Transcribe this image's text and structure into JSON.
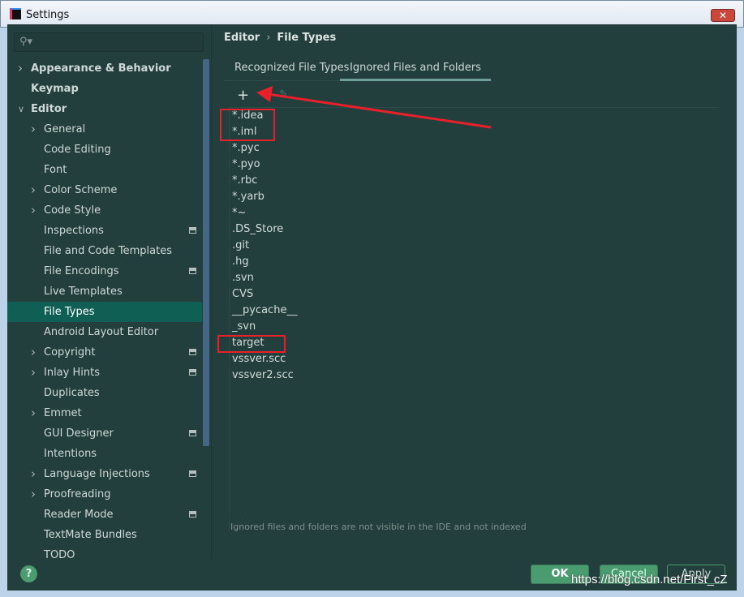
{
  "window": {
    "title": "Settings",
    "close": "✕"
  },
  "search": {
    "icon": "search-icon",
    "placeholder": ""
  },
  "sidebar": {
    "items": [
      {
        "label": "Appearance & Behavior",
        "level": 0,
        "chevron": "right",
        "bold": true
      },
      {
        "label": "Keymap",
        "level": 0,
        "chevron": "",
        "bold": true
      },
      {
        "label": "Editor",
        "level": 0,
        "chevron": "down",
        "bold": true
      },
      {
        "label": "General",
        "level": 1,
        "chevron": "right"
      },
      {
        "label": "Code Editing",
        "level": 1,
        "chevron": ""
      },
      {
        "label": "Font",
        "level": 1,
        "chevron": ""
      },
      {
        "label": "Color Scheme",
        "level": 1,
        "chevron": "right"
      },
      {
        "label": "Code Style",
        "level": 1,
        "chevron": "right"
      },
      {
        "label": "Inspections",
        "level": 1,
        "chevron": "",
        "badge": true
      },
      {
        "label": "File and Code Templates",
        "level": 1,
        "chevron": ""
      },
      {
        "label": "File Encodings",
        "level": 1,
        "chevron": "",
        "badge": true
      },
      {
        "label": "Live Templates",
        "level": 1,
        "chevron": ""
      },
      {
        "label": "File Types",
        "level": 1,
        "chevron": "",
        "selected": true
      },
      {
        "label": "Android Layout Editor",
        "level": 1,
        "chevron": ""
      },
      {
        "label": "Copyright",
        "level": 1,
        "chevron": "right",
        "badge": true
      },
      {
        "label": "Inlay Hints",
        "level": 1,
        "chevron": "right",
        "badge": true
      },
      {
        "label": "Duplicates",
        "level": 1,
        "chevron": ""
      },
      {
        "label": "Emmet",
        "level": 1,
        "chevron": "right"
      },
      {
        "label": "GUI Designer",
        "level": 1,
        "chevron": "",
        "badge": true
      },
      {
        "label": "Intentions",
        "level": 1,
        "chevron": ""
      },
      {
        "label": "Language Injections",
        "level": 1,
        "chevron": "right",
        "badge": true
      },
      {
        "label": "Proofreading",
        "level": 1,
        "chevron": "right"
      },
      {
        "label": "Reader Mode",
        "level": 1,
        "chevron": "",
        "badge": true
      },
      {
        "label": "TextMate Bundles",
        "level": 1,
        "chevron": ""
      },
      {
        "label": "TODO",
        "level": 1,
        "chevron": ""
      }
    ]
  },
  "breadcrumb": {
    "parent": "Editor",
    "separator": "›",
    "current": "File Types"
  },
  "tabs": [
    {
      "label": "Recognized File Types"
    },
    {
      "label": "Ignored Files and Folders",
      "active": true
    }
  ],
  "toolbar": {
    "add": "+",
    "edit": "✎"
  },
  "ignored": [
    "*.idea",
    "*.iml",
    "*.pyc",
    "*.pyo",
    "*.rbc",
    "*.yarb",
    "*~",
    ".DS_Store",
    ".git",
    ".hg",
    ".svn",
    "CVS",
    "__pycache__",
    "_svn",
    "target",
    "vssver.scc",
    "vssver2.scc"
  ],
  "hint": "Ignored files and folders are not visible in the IDE and not indexed",
  "footer": {
    "help": "?",
    "ok": "OK",
    "cancel": "Cancel",
    "apply": "Apply"
  },
  "watermark": "https://blog.csdn.net/First_cZ",
  "colors": {
    "background": "#223f3e",
    "selected": "#0f5f55",
    "button": "#4a9c70",
    "annotation": "#e8202a"
  }
}
